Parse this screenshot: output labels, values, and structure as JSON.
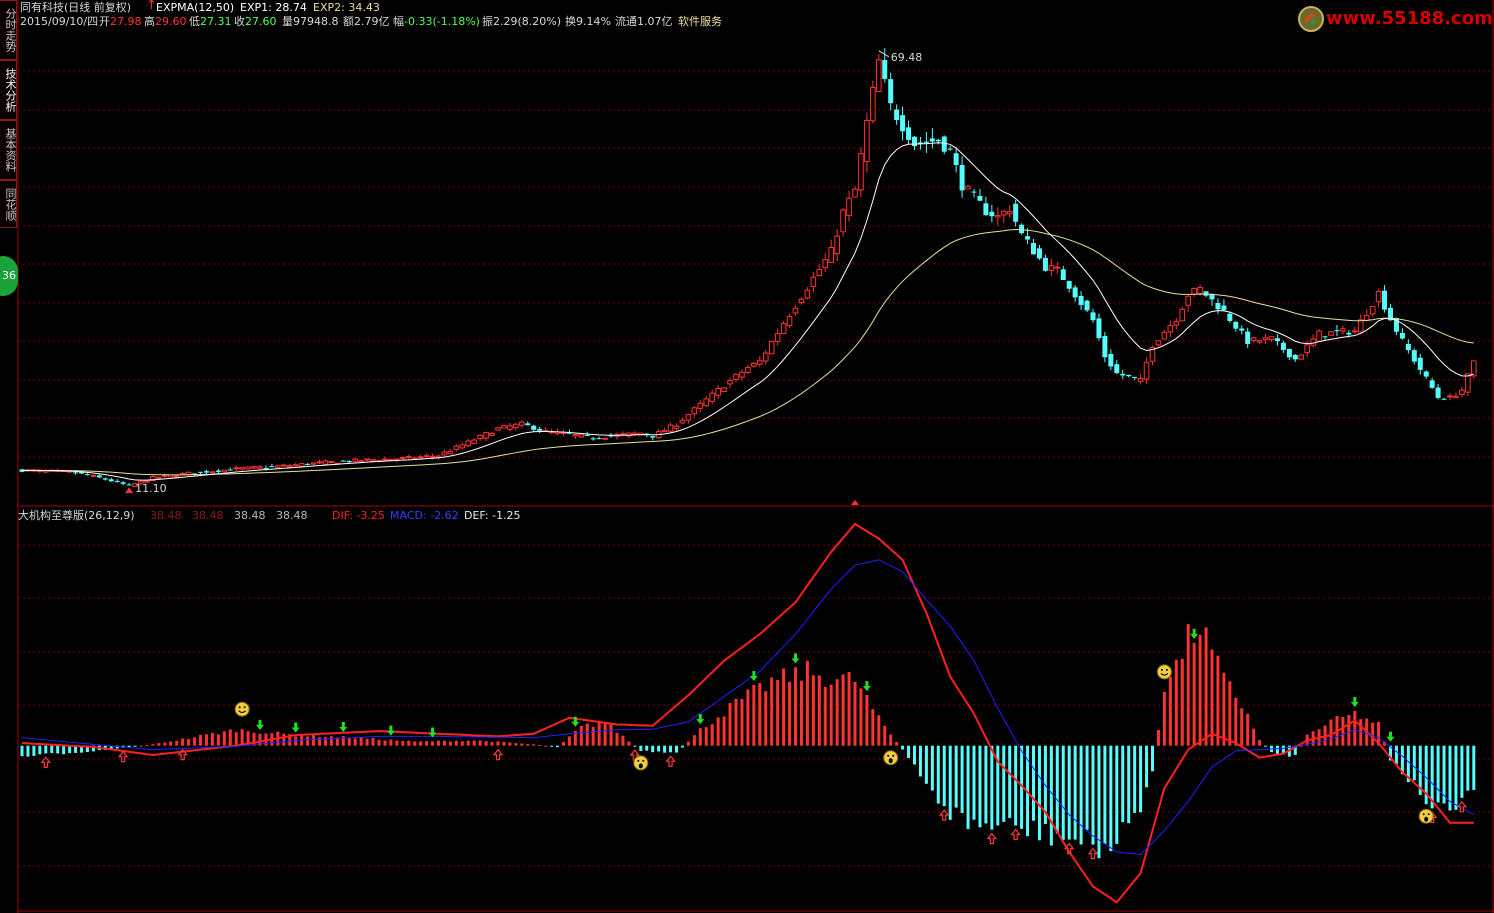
{
  "side_tabs": [
    {
      "label": "分时走势",
      "active": false
    },
    {
      "label": "技术分析",
      "active": true
    },
    {
      "label": "基本资料",
      "active": false
    },
    {
      "label": "同花顺",
      "active": false
    }
  ],
  "badge": "36",
  "logo": {
    "text": "www.55188.com"
  },
  "header": {
    "stock_title": "同有科技(日线 前复权)",
    "indicator_name": "EXPMA(12,50)",
    "exp1": "EXP1: 28.74",
    "exp2": "EXP2: 34.43"
  },
  "quote": {
    "date": "2015/09/10/四",
    "open_label": "开",
    "open": "27.98",
    "high_label": "高",
    "high": "29.60",
    "low_label": "低",
    "low": "27.31",
    "close_label": "收",
    "close": "27.60",
    "volume": "量97948.8",
    "amount": "额2.79亿",
    "change_label": "幅",
    "change": "-0.33(-1.18%)",
    "amplitude": "振2.29(8.20%)",
    "turnover": "换9.14%",
    "float_cap": "流通1.07亿",
    "sector": "软件服务"
  },
  "macd_header": {
    "name": "大机构至尊版(26,12,9)",
    "v1": "38.48",
    "v2": "38.48",
    "v3": "38.48",
    "v4": "38.48",
    "dif": "DIF: -3.25",
    "macd": "MACD: -2.62",
    "def": "DEF: -1.25"
  },
  "colors": {
    "up": "#ff3232",
    "down": "#54ffff",
    "exp1": "#ffffff",
    "exp2": "#e8e09a",
    "dif": "#ff2020",
    "macd": "#2020ff",
    "grid": "#7a0000",
    "border": "#a00000"
  },
  "chart_data": [
    {
      "type": "candlestick",
      "ylim": [
        9.5,
        72
      ],
      "annotations": [
        {
          "label": "69.48",
          "value": 69.48
        },
        {
          "label": "11.10",
          "value": 11.1
        }
      ],
      "anchors": [
        [
          0,
          13.2
        ],
        [
          8,
          13.0
        ],
        [
          12,
          12.4
        ],
        [
          16,
          11.6
        ],
        [
          18,
          11.1
        ],
        [
          22,
          12.2
        ],
        [
          28,
          12.8
        ],
        [
          36,
          13.4
        ],
        [
          44,
          13.8
        ],
        [
          50,
          14.2
        ],
        [
          58,
          14.6
        ],
        [
          64,
          14.8
        ],
        [
          70,
          15.2
        ],
        [
          74,
          16.6
        ],
        [
          80,
          18.8
        ],
        [
          84,
          19.4
        ],
        [
          88,
          18.4
        ],
        [
          92,
          18.0
        ],
        [
          96,
          17.6
        ],
        [
          100,
          17.9
        ],
        [
          104,
          18.2
        ],
        [
          106,
          17.8
        ],
        [
          110,
          19.4
        ],
        [
          114,
          22.0
        ],
        [
          118,
          24.6
        ],
        [
          122,
          27.0
        ],
        [
          124,
          27.8
        ],
        [
          128,
          33.0
        ],
        [
          132,
          37.8
        ],
        [
          136,
          42.5
        ],
        [
          138,
          47.8
        ],
        [
          140,
          50.8
        ],
        [
          142,
          59.8
        ],
        [
          144,
          68.0
        ],
        [
          146,
          62.0
        ],
        [
          150,
          57.0
        ],
        [
          154,
          57.5
        ],
        [
          156,
          56.0
        ],
        [
          158,
          51.5
        ],
        [
          162,
          48.0
        ],
        [
          164,
          47.2
        ],
        [
          166,
          48.4
        ],
        [
          168,
          44.8
        ],
        [
          172,
          40.5
        ],
        [
          174,
          40.0
        ],
        [
          176,
          38.0
        ],
        [
          180,
          33.3
        ],
        [
          182,
          28.5
        ],
        [
          184,
          26.2
        ],
        [
          188,
          25.2
        ],
        [
          190,
          30.1
        ],
        [
          194,
          33.6
        ],
        [
          196,
          36.8
        ],
        [
          198,
          37.5
        ],
        [
          202,
          34.5
        ],
        [
          206,
          30.5
        ],
        [
          210,
          30.8
        ],
        [
          214,
          28.1
        ],
        [
          218,
          31.5
        ],
        [
          224,
          31.9
        ],
        [
          228,
          37.0
        ],
        [
          230,
          33.5
        ],
        [
          232,
          30.5
        ],
        [
          236,
          25.5
        ],
        [
          238,
          23.0
        ],
        [
          240,
          22.9
        ],
        [
          242,
          24.0
        ],
        [
          244,
          27.6
        ]
      ]
    },
    {
      "type": "macd",
      "ylim": [
        -6,
        8.5
      ],
      "series": [
        {
          "name": "DIF",
          "anchors": [
            [
              0,
              0.1
            ],
            [
              12,
              -0.05
            ],
            [
              22,
              -0.35
            ],
            [
              36,
              0.0
            ],
            [
              46,
              0.4
            ],
            [
              60,
              0.55
            ],
            [
              70,
              0.45
            ],
            [
              80,
              0.35
            ],
            [
              86,
              0.45
            ],
            [
              92,
              1.05
            ],
            [
              100,
              0.8
            ],
            [
              106,
              0.75
            ],
            [
              112,
              1.9
            ],
            [
              118,
              3.2
            ],
            [
              124,
              4.2
            ],
            [
              130,
              5.4
            ],
            [
              136,
              7.3
            ],
            [
              140,
              8.35
            ],
            [
              144,
              7.8
            ],
            [
              148,
              7.0
            ],
            [
              152,
              5.0
            ],
            [
              156,
              2.6
            ],
            [
              160,
              1.2
            ],
            [
              164,
              -0.6
            ],
            [
              168,
              -1.5
            ],
            [
              172,
              -2.5
            ],
            [
              176,
              -4.0
            ],
            [
              180,
              -5.3
            ],
            [
              184,
              -5.9
            ],
            [
              188,
              -4.8
            ],
            [
              192,
              -1.6
            ],
            [
              196,
              -0.15
            ],
            [
              200,
              0.45
            ],
            [
              204,
              0.1
            ],
            [
              208,
              -0.45
            ],
            [
              212,
              -0.3
            ],
            [
              216,
              0.2
            ],
            [
              220,
              0.4
            ],
            [
              224,
              0.95
            ],
            [
              228,
              0.1
            ],
            [
              232,
              -1.0
            ],
            [
              236,
              -1.8
            ],
            [
              240,
              -2.9
            ],
            [
              244,
              -2.9
            ]
          ]
        },
        {
          "name": "MACD",
          "anchors": [
            [
              0,
              0.3
            ],
            [
              12,
              0.05
            ],
            [
              22,
              -0.15
            ],
            [
              36,
              -0.02
            ],
            [
              46,
              0.2
            ],
            [
              60,
              0.35
            ],
            [
              70,
              0.35
            ],
            [
              86,
              0.3
            ],
            [
              92,
              0.45
            ],
            [
              100,
              0.6
            ],
            [
              106,
              0.62
            ],
            [
              112,
              0.9
            ],
            [
              118,
              1.85
            ],
            [
              124,
              2.8
            ],
            [
              130,
              4.2
            ],
            [
              136,
              5.9
            ],
            [
              140,
              6.8
            ],
            [
              144,
              7.0
            ],
            [
              148,
              6.55
            ],
            [
              152,
              5.5
            ],
            [
              156,
              4.5
            ],
            [
              160,
              3.2
            ],
            [
              164,
              1.4
            ],
            [
              168,
              -0.2
            ],
            [
              172,
              -1.5
            ],
            [
              176,
              -2.6
            ],
            [
              180,
              -3.4
            ],
            [
              184,
              -4.0
            ],
            [
              188,
              -4.1
            ],
            [
              192,
              -3.2
            ],
            [
              196,
              -2.1
            ],
            [
              200,
              -0.8
            ],
            [
              204,
              -0.2
            ],
            [
              208,
              -0.15
            ],
            [
              212,
              -0.1
            ],
            [
              216,
              0.05
            ],
            [
              220,
              0.25
            ],
            [
              224,
              0.6
            ],
            [
              228,
              0.3
            ],
            [
              232,
              -0.4
            ],
            [
              236,
              -1.2
            ],
            [
              240,
              -2.1
            ],
            [
              244,
              -2.6
            ]
          ]
        }
      ],
      "bar_anchors": [
        [
          0,
          -0.4
        ],
        [
          12,
          -0.2
        ],
        [
          22,
          0.05
        ],
        [
          36,
          0.6
        ],
        [
          46,
          0.4
        ],
        [
          56,
          0.3
        ],
        [
          66,
          0.15
        ],
        [
          76,
          0.2
        ],
        [
          86,
          0.05
        ],
        [
          90,
          -0.05
        ],
        [
          94,
          0.7
        ],
        [
          98,
          0.9
        ],
        [
          104,
          -0.2
        ],
        [
          110,
          -0.3
        ],
        [
          114,
          0.6
        ],
        [
          120,
          1.6
        ],
        [
          126,
          2.4
        ],
        [
          132,
          2.8
        ],
        [
          136,
          2.5
        ],
        [
          140,
          2.5
        ],
        [
          144,
          1.0
        ],
        [
          148,
          -0.15
        ],
        [
          152,
          -1.5
        ],
        [
          156,
          -2.5
        ],
        [
          160,
          -3.0
        ],
        [
          164,
          -3.0
        ],
        [
          170,
          -3.2
        ],
        [
          176,
          -3.5
        ],
        [
          180,
          -3.8
        ],
        [
          184,
          -3.7
        ],
        [
          188,
          -2.2
        ],
        [
          190,
          -1.0
        ],
        [
          192,
          2.3
        ],
        [
          194,
          3.0
        ],
        [
          196,
          4.0
        ],
        [
          198,
          4.5
        ],
        [
          202,
          2.5
        ],
        [
          206,
          1.2
        ],
        [
          208,
          0.2
        ],
        [
          210,
          -0.25
        ],
        [
          214,
          -0.4
        ],
        [
          216,
          0.4
        ],
        [
          220,
          0.9
        ],
        [
          224,
          1.2
        ],
        [
          228,
          0.8
        ],
        [
          230,
          -0.5
        ],
        [
          234,
          -1.5
        ],
        [
          238,
          -2.5
        ],
        [
          242,
          -2.3
        ],
        [
          244,
          -1.5
        ]
      ],
      "signals": [
        {
          "type": "up_arrow",
          "bars": [
            4,
            17,
            27,
            80,
            103,
            109,
            155,
            163,
            167,
            176,
            180,
            237,
            242
          ]
        },
        {
          "type": "down_arrow",
          "bars": [
            40,
            46,
            54,
            62,
            69,
            93,
            114,
            123,
            130,
            142,
            197,
            224,
            230
          ]
        },
        {
          "type": "smile",
          "bars": [
            37,
            192
          ]
        },
        {
          "type": "frown",
          "bars": [
            104,
            146,
            236
          ]
        }
      ]
    }
  ]
}
